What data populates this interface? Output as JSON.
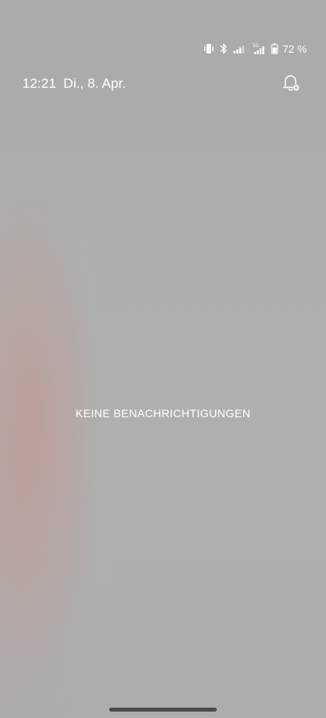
{
  "status_bar": {
    "icons": [
      "vibrate-icon",
      "bluetooth-icon",
      "wifi-signal-icon",
      "cellular-5g-signal-icon",
      "battery-icon"
    ],
    "network_label": "5G",
    "battery_text": "72 %",
    "battery_level": 0.72
  },
  "header": {
    "time": "12:21",
    "date": "Di., 8. Apr.",
    "settings_icon": "notification-settings-icon"
  },
  "notifications": {
    "empty_message": "KEINE BENACHRICHTIGUNGEN"
  },
  "colors": {
    "text": "#ffffff",
    "background": "#aeb0b0",
    "home_indicator": "#3a3a3a"
  }
}
